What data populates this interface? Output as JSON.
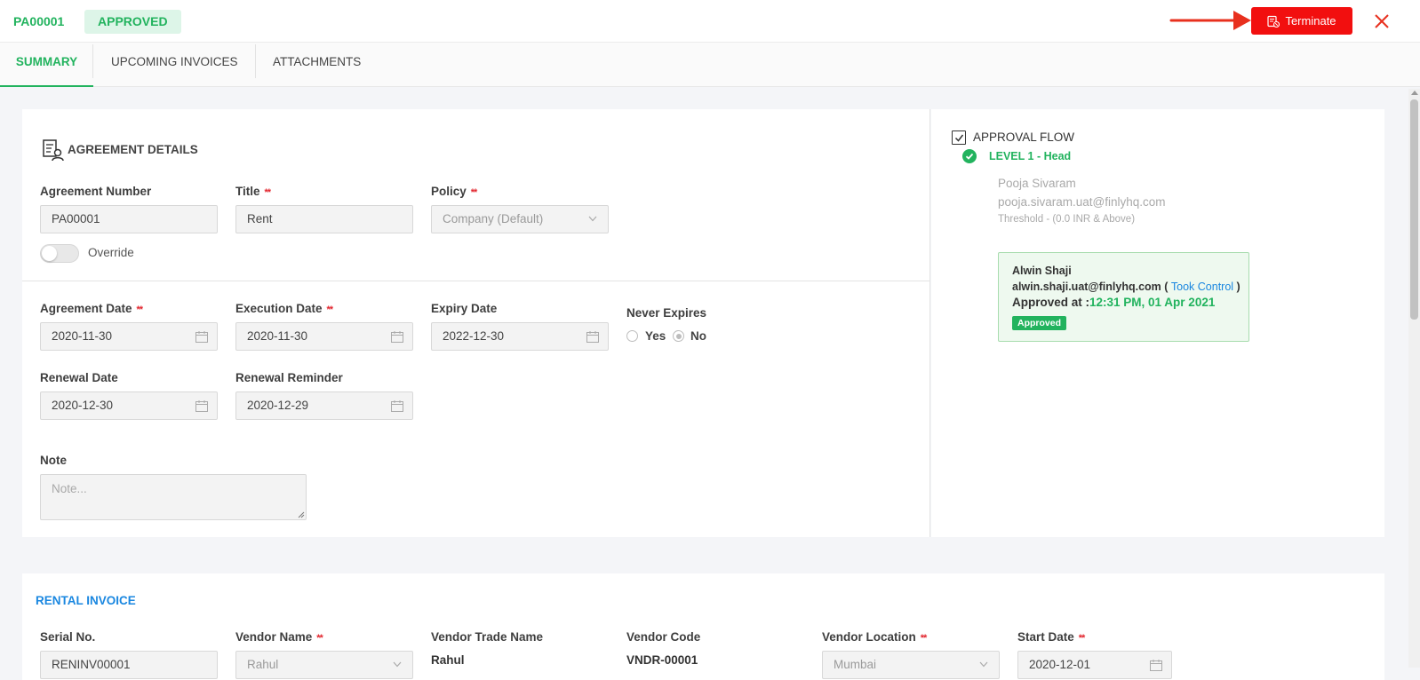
{
  "header": {
    "doc_id": "PA00001",
    "status": "APPROVED",
    "terminate_label": "Terminate",
    "accent": "#22b35e",
    "danger": "#f20f0f"
  },
  "tabs": [
    {
      "label": "SUMMARY",
      "active": true
    },
    {
      "label": "UPCOMING INVOICES",
      "active": false
    },
    {
      "label": "ATTACHMENTS",
      "active": false
    }
  ],
  "agreement": {
    "title": "AGREEMENT DETAILS",
    "agreement_number": {
      "label": "Agreement Number",
      "value": "PA00001"
    },
    "title_field": {
      "label": "Title",
      "value": "Rent",
      "required": "**"
    },
    "policy": {
      "label": "Policy",
      "value": "Company (Default)",
      "required": "**"
    },
    "override_label": "Override",
    "override_on": false,
    "agreement_date": {
      "label": "Agreement Date",
      "value": "2020-11-30",
      "required": "**"
    },
    "execution_date": {
      "label": "Execution Date",
      "value": "2020-11-30",
      "required": "**"
    },
    "expiry_date": {
      "label": "Expiry Date",
      "value": "2022-12-30"
    },
    "never_expires": {
      "label": "Never Expires",
      "yes": "Yes",
      "no": "No",
      "selected": "No"
    },
    "renewal_date": {
      "label": "Renewal Date",
      "value": "2020-12-30"
    },
    "renewal_reminder": {
      "label": "Renewal Reminder",
      "value": "2020-12-29"
    },
    "note": {
      "label": "Note",
      "placeholder": "Note..."
    }
  },
  "approval": {
    "title": "APPROVAL FLOW",
    "level": "LEVEL 1  -  Head",
    "approver_name": "Pooja Sivaram",
    "approver_email": "pooja.sivaram.uat@finlyhq.com",
    "threshold": "Threshold -  (0.0 INR   & Above)",
    "box": {
      "name": "Alwin Shaji",
      "email": "alwin.shaji.uat@finlyhq.com",
      "took_open": " ( ",
      "took_control": "Took Control",
      "took_close": " )",
      "approved_at_label": "Approved at :",
      "approved_at": "12:31 PM, 01 Apr 2021",
      "badge": "Approved"
    }
  },
  "rental": {
    "title": "RENTAL INVOICE",
    "serial_no": {
      "label": "Serial No.",
      "value": "RENINV00001"
    },
    "vendor_name": {
      "label": "Vendor Name",
      "value": "Rahul",
      "required": "**"
    },
    "vendor_trade_name": {
      "label": "Vendor Trade Name",
      "value": "Rahul"
    },
    "vendor_code": {
      "label": "Vendor Code",
      "value": "VNDR-00001"
    },
    "vendor_location": {
      "label": "Vendor Location",
      "value": "Mumbai",
      "required": "**"
    },
    "start_date": {
      "label": "Start Date",
      "value": "2020-12-01",
      "required": "**"
    }
  }
}
